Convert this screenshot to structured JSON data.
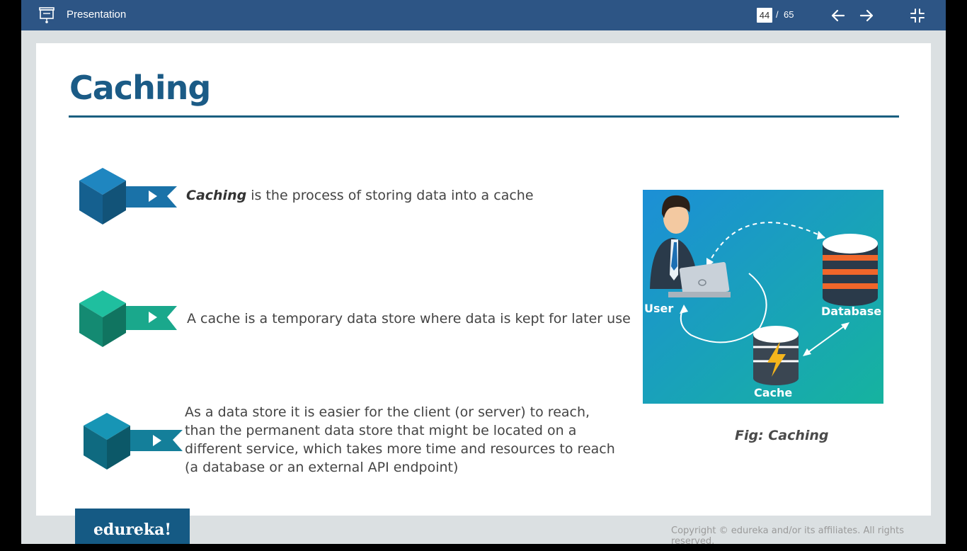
{
  "topbar": {
    "title": "Presentation",
    "icon": "presentation-icon",
    "current_page": "44",
    "page_separator": "/",
    "total_pages": "65",
    "prev_icon": "arrow-left-icon",
    "next_icon": "arrow-right-icon",
    "exit_fullscreen_icon": "exit-fullscreen-icon"
  },
  "slide": {
    "title": "Caching",
    "bullets": [
      {
        "em": "Caching",
        "text": " is the process of storing data into a cache",
        "color": "#1a72a8"
      },
      {
        "em": "",
        "text": "A cache is a temporary data store where data is kept for later use",
        "color": "#1aa88c"
      },
      {
        "em": "",
        "text": "As a data store it is easier for the client (or server) to reach, than the permanent data store that might be located on a different service, which takes more time and resources to reach (a database or an external API endpoint)",
        "color": "#147f9a"
      }
    ],
    "figure": {
      "labels": {
        "user": "User",
        "database": "Database",
        "cache": "Cache"
      },
      "caption": "Fig: Caching"
    }
  },
  "footer": {
    "logo": "edureka!",
    "copyright": "Copyright © edureka and/or its affiliates. All rights reserved."
  },
  "colors": {
    "topbar": "#2d5585",
    "title": "#1b5b86",
    "logo_bg": "#155a84"
  }
}
